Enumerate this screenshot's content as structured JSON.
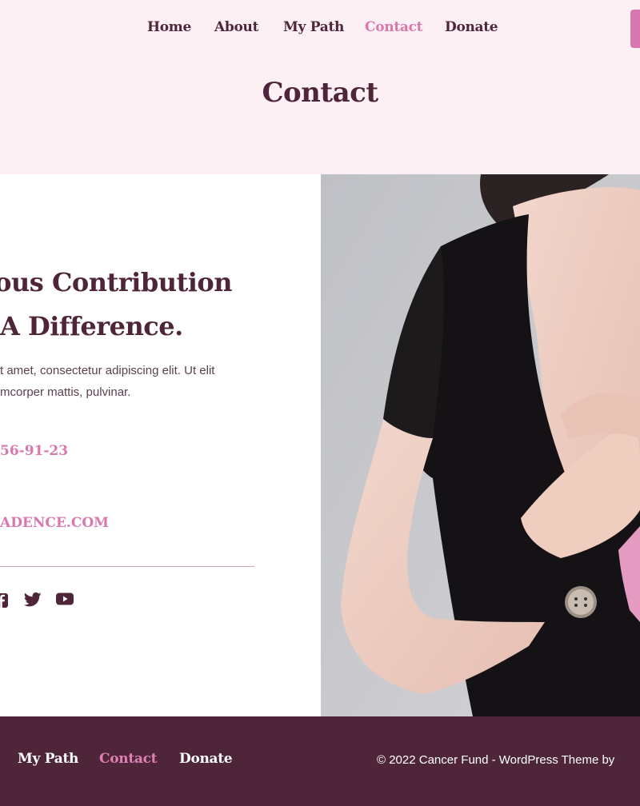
{
  "header": {
    "nav": [
      {
        "label": "Home",
        "active": false
      },
      {
        "label": "About",
        "active": false
      },
      {
        "label": "My Path",
        "active": false
      },
      {
        "label": "Contact",
        "active": true
      },
      {
        "label": "Donate",
        "active": false
      }
    ],
    "page_title": "Contact"
  },
  "contact": {
    "headline_line1": "erous Contribution",
    "headline_line2": "A Difference.",
    "desc_line1": "t amet, consectetur adipiscing elit. Ut elit",
    "desc_line2": "mcorper mattis, pulvinar.",
    "phone": "56-91-23",
    "email": "ADENCE.COM",
    "social_icons": [
      "facebook-icon",
      "twitter-icon",
      "youtube-icon"
    ]
  },
  "footer": {
    "nav": [
      {
        "label": "My Path",
        "active": false
      },
      {
        "label": "Contact",
        "active": true
      },
      {
        "label": "Donate",
        "active": false
      }
    ],
    "copyright": "© 2022 Cancer Fund - WordPress Theme by"
  },
  "colors": {
    "header_bg": "#fcf0f5",
    "dark": "#4f2639",
    "accent": "#d978ad",
    "footer_bg": "#4f2639"
  }
}
